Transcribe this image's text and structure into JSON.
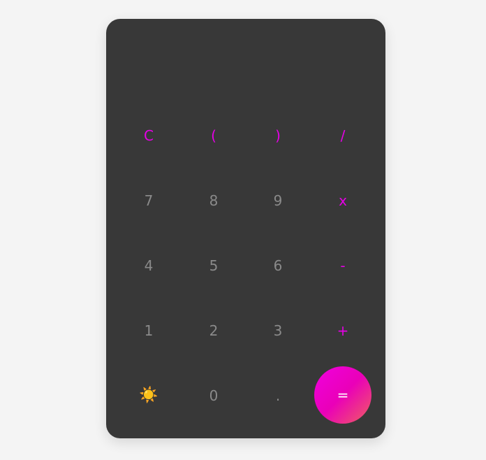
{
  "display": {
    "value": ""
  },
  "keys": {
    "clear": "C",
    "open_paren": "(",
    "close_paren": ")",
    "divide": "/",
    "seven": "7",
    "eight": "8",
    "nine": "9",
    "multiply": "x",
    "four": "4",
    "five": "5",
    "six": "6",
    "subtract": "-",
    "one": "1",
    "two": "2",
    "three": "3",
    "add": "+",
    "theme_toggle": "☀️",
    "zero": "0",
    "decimal": ".",
    "equals": "="
  },
  "colors": {
    "background": "#f4f4f4",
    "panel": "#383838",
    "number_key": "#8a8a8a",
    "operator_key": "#e600e6",
    "equals_gradient_start": "#f000e0",
    "equals_gradient_end": "#f06060"
  },
  "icons": {
    "theme_toggle": "sun-icon"
  }
}
